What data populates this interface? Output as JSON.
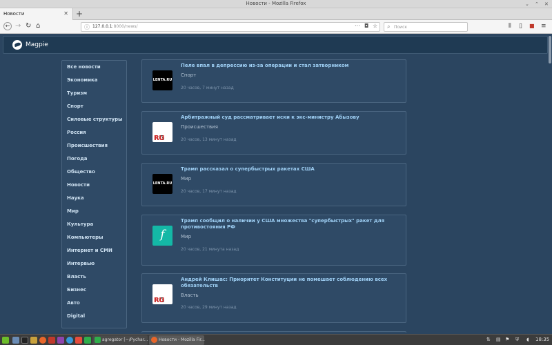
{
  "window": {
    "title": "Новости - Mozilla Firefox",
    "btn_min": "⌄",
    "btn_max": "⌃",
    "btn_close": "✕"
  },
  "tab": {
    "title": "Новости",
    "close": "✕",
    "new_tab": "+"
  },
  "nav": {
    "url_host": "127.0.0.1",
    "url_path": ":8000/news/",
    "search_placeholder": "Поиск",
    "icons": [
      "back-icon",
      "forward-icon",
      "reload-icon",
      "home-icon",
      "page-actions-icon",
      "pocket-icon",
      "bookmark-star-icon",
      "search-icon",
      "library-icon",
      "sidebar-icon",
      "extension-icon",
      "menu-icon"
    ]
  },
  "brand": {
    "name": "Magpie"
  },
  "categories": [
    "Все новости",
    "Экономика",
    "Туризм",
    "Спорт",
    "Силовые структуры",
    "Россия",
    "Происшествия",
    "Погода",
    "Общество",
    "Новости",
    "Наука",
    "Мир",
    "Культура",
    "Компьютеры",
    "Интернет и СМИ",
    "Интервью",
    "Власть",
    "Бизнес",
    "Авто",
    "Digital"
  ],
  "news": [
    {
      "title": "Пеле впал в депрессию из-за операции и стал затворником",
      "category": "Спорт",
      "time": "20 часов, 7 минут назад",
      "source_logo": "LENTA.RU"
    },
    {
      "title": "Арбитражный суд рассматривает иски к экс-министру Абызову",
      "category": "Происшествия",
      "time": "20 часов, 13 минут назад",
      "source_logo_rg": "RG",
      "source_logo_ru": "RU"
    },
    {
      "title": "Трамп рассказал о супербыстрых ракетах США",
      "category": "Мир",
      "time": "20 часов, 17 минут назад",
      "source_logo": "LENTA.RU"
    },
    {
      "title": "Трамп сообщил о наличии у США множества \"супербыстрых\" ракет для противостояния РФ",
      "category": "Мир",
      "time": "20 часов, 21 минута назад",
      "source_logo": "f"
    },
    {
      "title": "Андрей Клишас: Приоритет Конституции не помешает соблюдению всех обязательств",
      "category": "Власть",
      "time": "20 часов, 29 минут назад",
      "source_logo_rg": "RG",
      "source_logo_ru": "RU"
    }
  ],
  "taskbar": {
    "tasks": [
      "agregator [~/Pychar...",
      "Новости - Mozilla Fir..."
    ],
    "clock": "18:35",
    "colors": {
      "menu": "#6cbc2a",
      "files": "#c8a13c",
      "firefox": "#e8662a",
      "terminal": "#222222",
      "editor": "#c0392b",
      "pycharm": "#2fae4b"
    }
  }
}
